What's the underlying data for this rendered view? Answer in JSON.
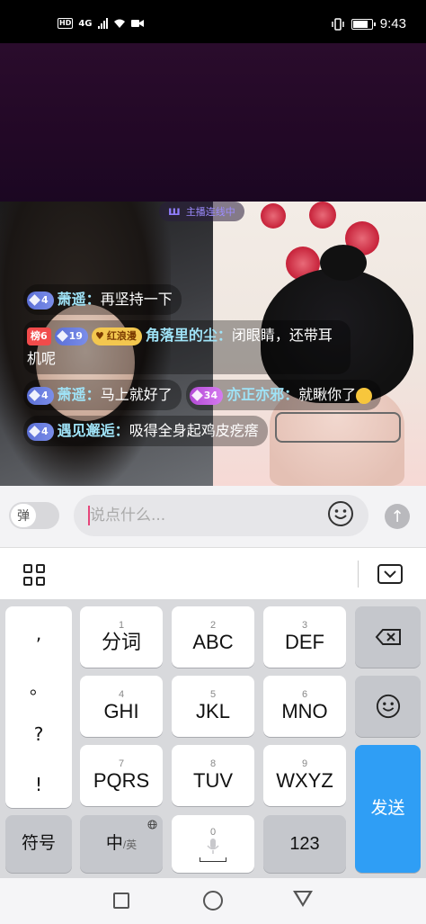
{
  "status": {
    "hd": "HD",
    "network": "4G",
    "time": "9:43",
    "battery_level": 0.85
  },
  "live": {
    "connect_status": "主播连线中"
  },
  "comments": [
    {
      "badge": "4",
      "user": "萧遥",
      "sep": "：",
      "text": "再坚持一下"
    },
    {
      "rank": "榜6",
      "badge": "19",
      "fan": "红浪漫",
      "user": "角落里的尘",
      "sep": "：",
      "text": "闭眼睛，还带耳机呢"
    },
    {
      "badge": "4",
      "user": "萧遥",
      "sep": "：",
      "text": "马上就好了"
    },
    {
      "badge": "34",
      "user": "亦正亦邪",
      "sep": "：",
      "text": "就瞅你了"
    },
    {
      "badge": "4",
      "user": "遇见邂逅",
      "sep": "：",
      "text": "吸得全身起鸡皮疙瘩"
    }
  ],
  "input_bar": {
    "danmu_toggle": "弹",
    "placeholder": "说点什么..."
  },
  "keyboard": {
    "punct": [
      ",",
      "。",
      "?",
      "!"
    ],
    "row1": [
      {
        "num": "1",
        "label": "分词"
      },
      {
        "num": "2",
        "label": "ABC"
      },
      {
        "num": "3",
        "label": "DEF"
      }
    ],
    "row2": [
      {
        "num": "4",
        "label": "GHI"
      },
      {
        "num": "5",
        "label": "JKL"
      },
      {
        "num": "6",
        "label": "MNO"
      }
    ],
    "row3": [
      {
        "num": "7",
        "label": "PQRS"
      },
      {
        "num": "8",
        "label": "TUV"
      },
      {
        "num": "9",
        "label": "WXYZ"
      }
    ],
    "symbols": "符号",
    "lang_main": "中",
    "lang_alt": "/英",
    "space_num": "0",
    "num_key": "123",
    "send": "发送"
  },
  "icons": {
    "menu": "grid-icon",
    "collapse": "keyboard-collapse-icon",
    "backspace": "backspace-icon",
    "emoji": "smiley-icon"
  }
}
